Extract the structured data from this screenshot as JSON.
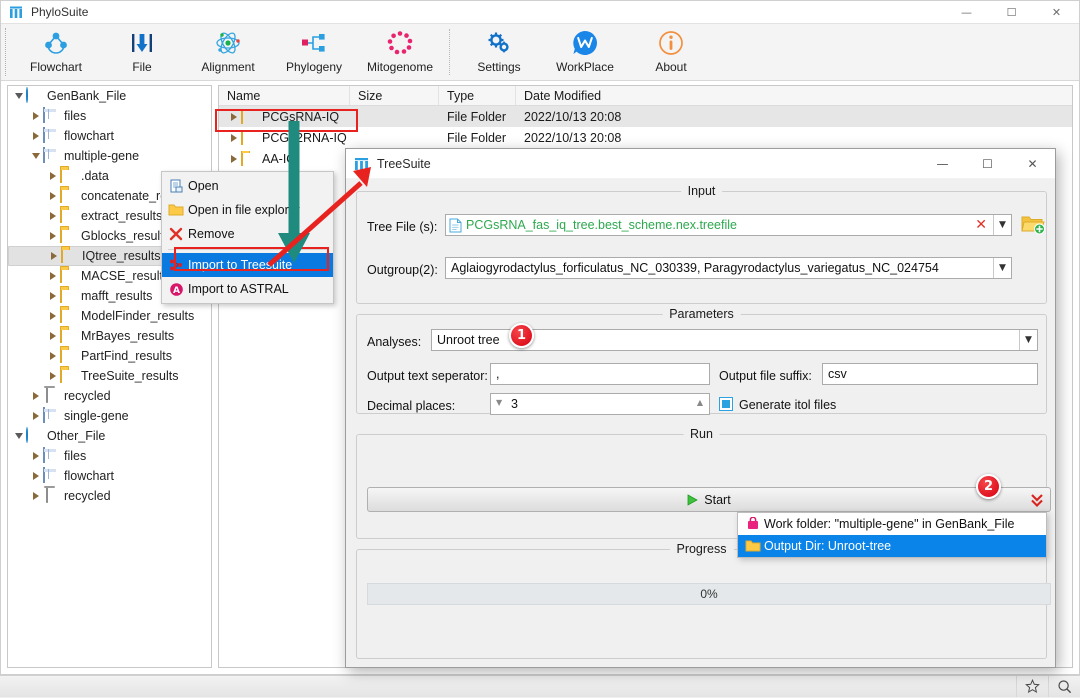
{
  "app": {
    "title": "PhyloSuite",
    "icon": "phylosuite-logo-icon",
    "window_buttons": {
      "minimize": "—",
      "maximize": "☐",
      "close": "✕"
    }
  },
  "toolbar": {
    "items": [
      {
        "label": "Flowchart",
        "icon": "flowchart-icon"
      },
      {
        "label": "File",
        "icon": "file-import-icon"
      },
      {
        "label": "Alignment",
        "icon": "alignment-atom-icon"
      },
      {
        "label": "Phylogeny",
        "icon": "phylogeny-tree-icon"
      },
      {
        "label": "Mitogenome",
        "icon": "mitogenome-circle-icon"
      },
      {
        "label": "Settings",
        "icon": "gear-icon"
      },
      {
        "label": "WorkPlace",
        "icon": "workplace-icon"
      },
      {
        "label": "About",
        "icon": "info-icon"
      }
    ]
  },
  "tree_panel": {
    "nodes": [
      {
        "label": "GenBank_File",
        "indent": 0,
        "expander": "down",
        "icon": "blue-arrow-icon"
      },
      {
        "label": "files",
        "indent": 1,
        "expander": "right",
        "icon": "grid-icon"
      },
      {
        "label": "flowchart",
        "indent": 1,
        "expander": "right",
        "icon": "grid-icon"
      },
      {
        "label": "multiple-gene",
        "indent": 1,
        "expander": "down",
        "icon": "grid-icon"
      },
      {
        "label": ".data",
        "indent": 2,
        "expander": "right",
        "icon": "folder-icon"
      },
      {
        "label": "concatenate_results",
        "indent": 2,
        "expander": "right",
        "icon": "folder-icon"
      },
      {
        "label": "extract_results",
        "indent": 2,
        "expander": "right",
        "icon": "folder-icon"
      },
      {
        "label": "Gblocks_results",
        "indent": 2,
        "expander": "right",
        "icon": "folder-icon"
      },
      {
        "label": "IQtree_results",
        "indent": 2,
        "expander": "right",
        "icon": "folder-icon",
        "selected": true
      },
      {
        "label": "MACSE_results",
        "indent": 2,
        "expander": "right",
        "icon": "folder-icon"
      },
      {
        "label": "mafft_results",
        "indent": 2,
        "expander": "right",
        "icon": "folder-icon"
      },
      {
        "label": "ModelFinder_results",
        "indent": 2,
        "expander": "right",
        "icon": "folder-icon"
      },
      {
        "label": "MrBayes_results",
        "indent": 2,
        "expander": "right",
        "icon": "folder-icon"
      },
      {
        "label": "PartFind_results",
        "indent": 2,
        "expander": "right",
        "icon": "folder-icon"
      },
      {
        "label": "TreeSuite_results",
        "indent": 2,
        "expander": "right",
        "icon": "folder-icon"
      },
      {
        "label": "recycled",
        "indent": 1,
        "expander": "right",
        "icon": "trash-icon"
      },
      {
        "label": "single-gene",
        "indent": 1,
        "expander": "right",
        "icon": "grid-icon"
      },
      {
        "label": "Other_File",
        "indent": 0,
        "expander": "down",
        "icon": "blue-arrow-icon"
      },
      {
        "label": "files",
        "indent": 1,
        "expander": "right",
        "icon": "grid-icon"
      },
      {
        "label": "flowchart",
        "indent": 1,
        "expander": "right",
        "icon": "grid-icon"
      },
      {
        "label": "recycled",
        "indent": 1,
        "expander": "right",
        "icon": "trash-icon"
      }
    ]
  },
  "file_list": {
    "columns": [
      "Name",
      "Size",
      "Type",
      "Date Modified"
    ],
    "rows": [
      {
        "name": "PCGsRNA-IQ",
        "size": "",
        "type": "File Folder",
        "date": "2022/10/13 20:08",
        "selected": true,
        "highlighted": true
      },
      {
        "name": "PCG12RNA-IQ",
        "size": "",
        "type": "File Folder",
        "date": "2022/10/13 20:08",
        "selected": false,
        "highlighted": false
      },
      {
        "name": "AA-IQ",
        "size": "",
        "type": "",
        "date": "",
        "selected": false,
        "highlighted": false
      }
    ]
  },
  "context_menu": {
    "items": [
      {
        "label": "Open",
        "icon": "open-document-icon",
        "active": false
      },
      {
        "label": "Open in file explorer",
        "icon": "folder-icon",
        "active": false
      },
      {
        "label": "Remove",
        "icon": "red-x-icon",
        "active": false
      },
      {
        "label": "Import to Treesuite",
        "icon": "treesuite-icon",
        "active": true,
        "highlighted": true
      },
      {
        "label": "Import to ASTRAL",
        "icon": "astral-a-icon",
        "active": false
      }
    ]
  },
  "dialog": {
    "title": "TreeSuite",
    "icon": "treesuite-icon",
    "window_buttons": {
      "minimize": "—",
      "maximize": "☐",
      "close": "✕"
    },
    "input_group": {
      "legend": "Input",
      "tree_file_label": "Tree File (s):",
      "tree_file_value": "PCGsRNA_fas_iq_tree.best_scheme.nex.treefile",
      "tree_file_value_color": "#2ea84f",
      "clear_icon": "red-x-icon",
      "dropdown_icon": "chevron-down-icon",
      "browse_icon": "add-folder-icon",
      "outgroup_label": "Outgroup(2):",
      "outgroup_value": "Aglaiogyrodactylus_forficulatus_NC_030339, Paragyrodactylus_variegatus_NC_024754"
    },
    "parameters_group": {
      "legend": "Parameters",
      "analyses_label": "Analyses:",
      "analyses_value": "Unroot tree",
      "separator_label": "Output text seperator:",
      "separator_value": ",",
      "suffix_label": "Output file suffix:",
      "suffix_value": "csv",
      "decimal_label": "Decimal places:",
      "decimal_value": "3",
      "itol_checkbox_label": "Generate itol files",
      "itol_checked": true
    },
    "run_group": {
      "legend": "Run",
      "start_label": "Start",
      "start_icon": "play-icon",
      "dropdown_icon": "double-chevron-down-icon",
      "menu_items": [
        {
          "label": "Work folder: \"multiple-gene\" in GenBank_File",
          "icon": "pink-bag-icon",
          "selected": false
        },
        {
          "label": "Output Dir: Unroot-tree",
          "icon": "folder-icon",
          "selected": true
        }
      ]
    },
    "progress_group": {
      "legend": "Progress",
      "value": "0%"
    }
  },
  "annotations": {
    "badge1": "1",
    "badge2": "2",
    "badge_color": "#e00010",
    "teal_arrow_color": "#1f8a7e",
    "red_arrow_color": "#e8231f",
    "highlight_box_color": "#e8231f"
  },
  "status_bar": {
    "buttons": [
      {
        "icon": "star-icon",
        "label": ""
      },
      {
        "icon": "search-icon",
        "label": ""
      }
    ]
  }
}
